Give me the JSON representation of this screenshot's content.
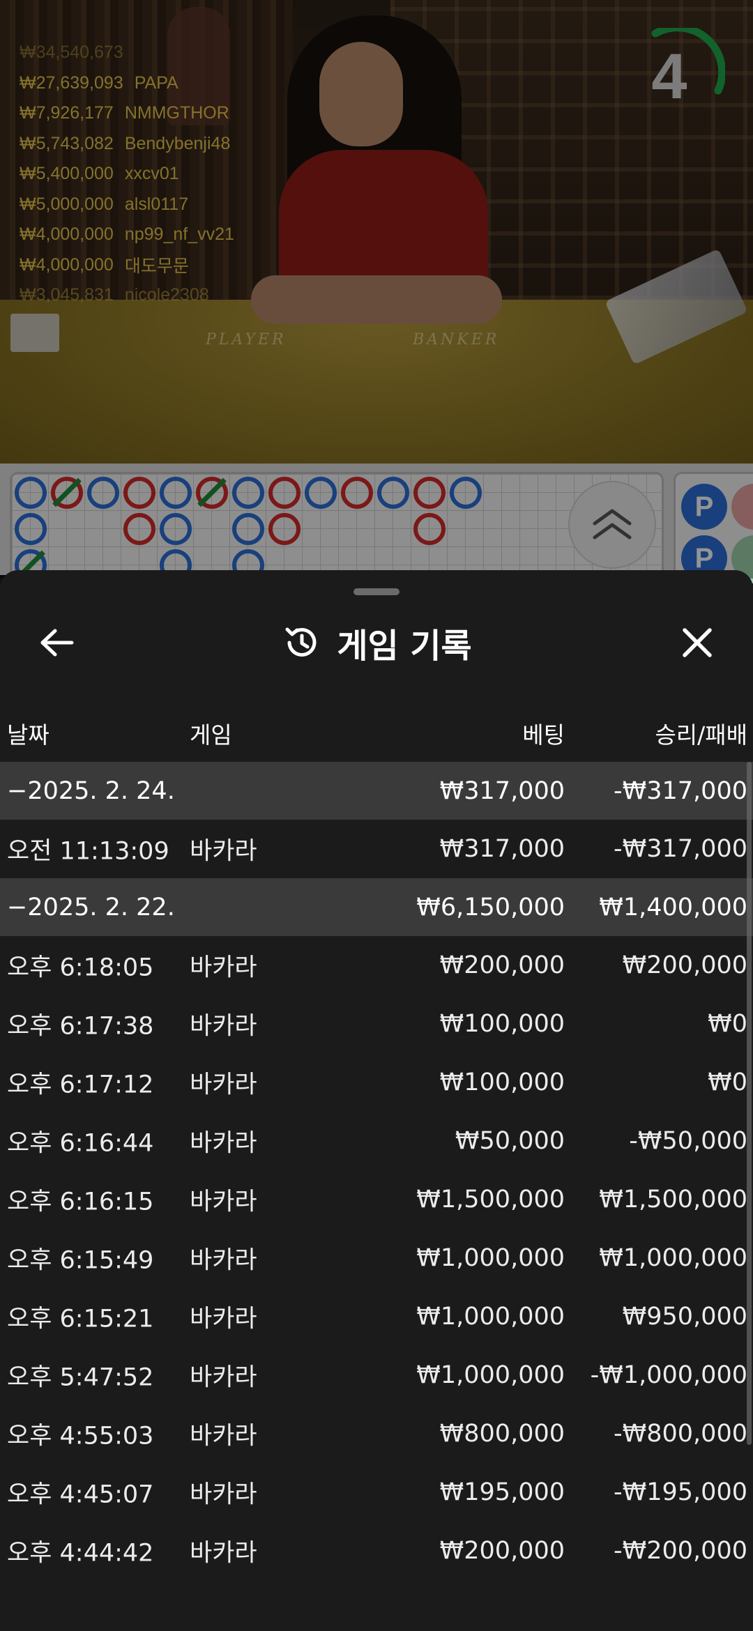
{
  "stream": {
    "countdown": "4",
    "table_labels": {
      "player": "PLAYER",
      "banker": "BANKER"
    },
    "recent_winners": [
      {
        "amount": "₩34,540,673",
        "name": ""
      },
      {
        "amount": "₩27,639,093",
        "name": "PAPA"
      },
      {
        "amount": "₩7,926,177",
        "name": "NMMGTHOR"
      },
      {
        "amount": "₩5,743,082",
        "name": "Bendybenji48"
      },
      {
        "amount": "₩5,400,000",
        "name": "xxcv01"
      },
      {
        "amount": "₩5,000,000",
        "name": "alsl0117"
      },
      {
        "amount": "₩4,000,000",
        "name": "np99_nf_vv21"
      },
      {
        "amount": "₩4,000,000",
        "name": "대도무문"
      },
      {
        "amount": "₩3,045,831",
        "name": "nicole2308"
      }
    ]
  },
  "roadmap": {
    "side_chips": [
      "P",
      "P"
    ],
    "colors": {
      "player": "#2b6fd6",
      "banker": "#d42a2a",
      "tie": "#1f8a3a"
    }
  },
  "sheet": {
    "title": "게임 기록",
    "icons": {
      "back": "arrow-left-icon",
      "history": "history-icon",
      "close": "close-icon",
      "expand": "chevron-double-up-icon"
    },
    "columns": {
      "date": "날짜",
      "game": "게임",
      "bet": "베팅",
      "win_loss": "승리/패배"
    },
    "groups": [
      {
        "date": "−2025. 2. 24.",
        "bet": "₩317,000",
        "win_loss": "-₩317,000",
        "rows": [
          {
            "time": "오전 11:13:09",
            "game": "바카라",
            "bet": "₩317,000",
            "win_loss": "-₩317,000"
          }
        ]
      },
      {
        "date": "−2025. 2. 22.",
        "bet": "₩6,150,000",
        "win_loss": "₩1,400,000",
        "rows": [
          {
            "time": "오후 6:18:05",
            "game": "바카라",
            "bet": "₩200,000",
            "win_loss": "₩200,000"
          },
          {
            "time": "오후 6:17:38",
            "game": "바카라",
            "bet": "₩100,000",
            "win_loss": "₩0"
          },
          {
            "time": "오후 6:17:12",
            "game": "바카라",
            "bet": "₩100,000",
            "win_loss": "₩0"
          },
          {
            "time": "오후 6:16:44",
            "game": "바카라",
            "bet": "₩50,000",
            "win_loss": "-₩50,000"
          },
          {
            "time": "오후 6:16:15",
            "game": "바카라",
            "bet": "₩1,500,000",
            "win_loss": "₩1,500,000"
          },
          {
            "time": "오후 6:15:49",
            "game": "바카라",
            "bet": "₩1,000,000",
            "win_loss": "₩1,000,000"
          },
          {
            "time": "오후 6:15:21",
            "game": "바카라",
            "bet": "₩1,000,000",
            "win_loss": "₩950,000"
          },
          {
            "time": "오후 5:47:52",
            "game": "바카라",
            "bet": "₩1,000,000",
            "win_loss": "-₩1,000,000"
          },
          {
            "time": "오후 4:55:03",
            "game": "바카라",
            "bet": "₩800,000",
            "win_loss": "-₩800,000"
          },
          {
            "time": "오후 4:45:07",
            "game": "바카라",
            "bet": "₩195,000",
            "win_loss": "-₩195,000"
          },
          {
            "time": "오후 4:44:42",
            "game": "바카라",
            "bet": "₩200,000",
            "win_loss": "-₩200,000"
          }
        ]
      }
    ]
  }
}
